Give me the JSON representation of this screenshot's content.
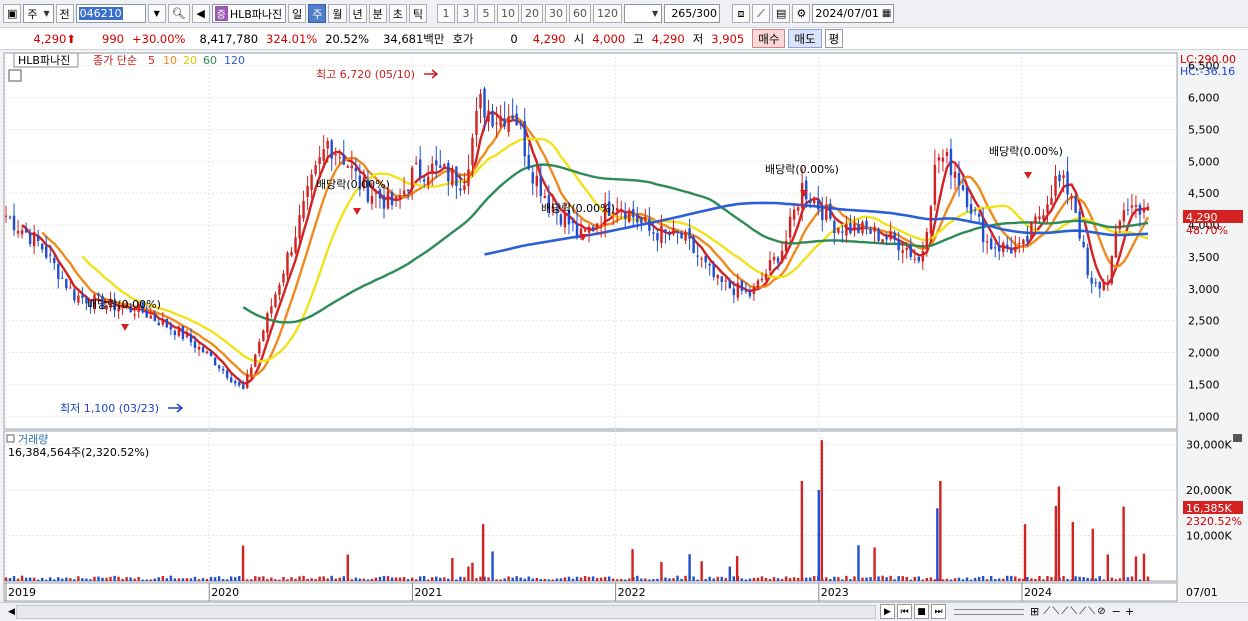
{
  "toolbar": {
    "type_label": "주",
    "prev_label": "전",
    "code": "046210",
    "name_tag": "증",
    "name": "HLB파나진",
    "period_day": "일",
    "period_week": "주",
    "period_month": "월",
    "period_year": "년",
    "period_minute": "분",
    "period_second": "초",
    "period_tick": "틱",
    "intervals": [
      "1",
      "3",
      "5",
      "10",
      "20",
      "30",
      "60",
      "120"
    ],
    "count": "265",
    "count_total": "/300",
    "date": "2024/07/01"
  },
  "quote": {
    "price": "4,290",
    "up_arrow": "⬆",
    "change": "990",
    "change_pct": "+30.00%",
    "volume": "8,417,780",
    "volume_ratio": "324.01%",
    "turnover": "20.52%",
    "amount": "34,681백만",
    "hoga_label": "호가",
    "hoga_val": "0",
    "hoga_price": "4,290",
    "open_label": "시",
    "open": "4,000",
    "high_label": "고",
    "high": "4,290",
    "low_label": "저",
    "low": "3,905",
    "buy_label": "매수",
    "sell_label": "매도",
    "flat_label": "평"
  },
  "legend": {
    "stock_name": "HLB파나진",
    "ma_prefix": "종가 단순",
    "ma": [
      {
        "label": "5",
        "color": "#d42121"
      },
      {
        "label": "10",
        "color": "#f08a1c"
      },
      {
        "label": "20",
        "color": "#f2e21a"
      },
      {
        "label": "60",
        "color": "#2e8b57"
      },
      {
        "label": "120",
        "color": "#2a5fd8"
      }
    ]
  },
  "right_axis": {
    "lc": "LC:290.00",
    "hc": "HC:-36.16",
    "current_price": "4,290",
    "current_pct": "48.70%",
    "vol_current": "16,385K",
    "vol_pct": "2320.52%"
  },
  "annotations": {
    "high": "최고 6,720 (05/10)",
    "low": "최저 1,100 (03/23)",
    "dividend": "배당락(0.00%)"
  },
  "volume_panel": {
    "title": "거래량",
    "value": "16,384,564주(2,320.52%)"
  },
  "chart_data": {
    "type": "candlestick",
    "price_ticks": [
      "6,500",
      "6,000",
      "5,500",
      "5,000",
      "4,500",
      "4,000",
      "3,500",
      "3,000",
      "2,500",
      "2,000",
      "1,500",
      "1,000"
    ],
    "volume_ticks": [
      "30,000K",
      "20,000K",
      "10,000K"
    ],
    "x_labels": [
      "2019",
      "2020",
      "2021",
      "2022",
      "2023",
      "2024",
      "07/01"
    ],
    "price_ylim": [
      800,
      6700
    ],
    "volume_ylim": [
      0,
      33000
    ],
    "series_close": [
      [
        "2019-01",
        4150
      ],
      [
        "2019-03",
        3700
      ],
      [
        "2019-05",
        2900
      ],
      [
        "2019-07",
        2750
      ],
      [
        "2019-09",
        2650
      ],
      [
        "2019-11",
        2350
      ],
      [
        "2020-01",
        1950
      ],
      [
        "2020-03",
        1400
      ],
      [
        "2020-04",
        2200
      ],
      [
        "2020-05",
        3000
      ],
      [
        "2020-06",
        3800
      ],
      [
        "2020-07",
        4600
      ],
      [
        "2020-08",
        5300
      ],
      [
        "2020-09",
        5050
      ],
      [
        "2020-10",
        4600
      ],
      [
        "2020-12",
        4300
      ],
      [
        "2021-01",
        4800
      ],
      [
        "2021-02",
        4900
      ],
      [
        "2021-04",
        4700
      ],
      [
        "2021-05",
        5900
      ],
      [
        "2021-06",
        5700
      ],
      [
        "2021-07",
        5800
      ],
      [
        "2021-08",
        4900
      ],
      [
        "2021-09",
        4400
      ],
      [
        "2021-11",
        3800
      ],
      [
        "2022-01",
        4400
      ],
      [
        "2022-03",
        3900
      ],
      [
        "2022-05",
        3800
      ],
      [
        "2022-07",
        3100
      ],
      [
        "2022-09",
        2900
      ],
      [
        "2022-11",
        3700
      ],
      [
        "2022-12",
        4600
      ],
      [
        "2023-02",
        4000
      ],
      [
        "2023-04",
        3900
      ],
      [
        "2023-06",
        3700
      ],
      [
        "2023-07",
        3400
      ],
      [
        "2023-08",
        5100
      ],
      [
        "2023-09",
        4900
      ],
      [
        "2023-11",
        3700
      ],
      [
        "2024-01",
        3600
      ],
      [
        "2024-03",
        4700
      ],
      [
        "2024-04",
        4500
      ],
      [
        "2024-05",
        3000
      ],
      [
        "2024-06",
        3100
      ],
      [
        "2024-07",
        4290
      ]
    ]
  }
}
